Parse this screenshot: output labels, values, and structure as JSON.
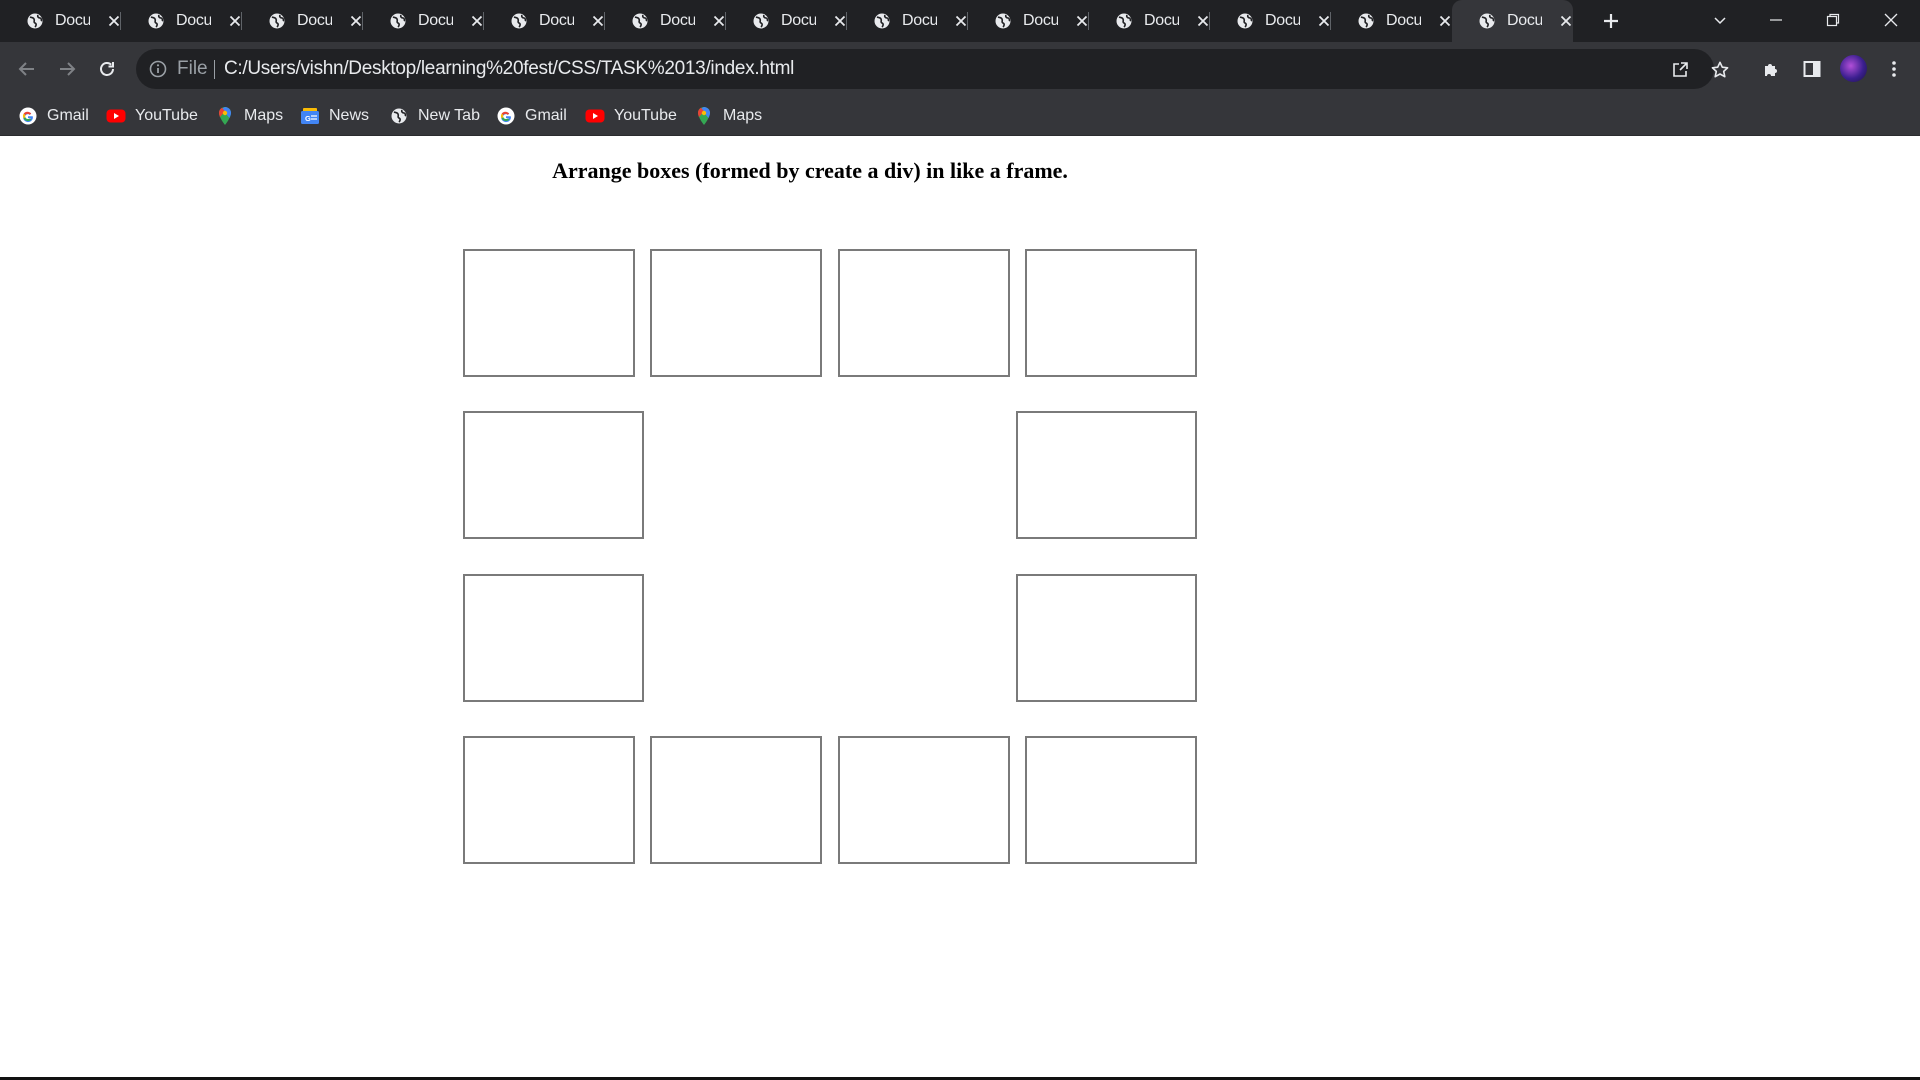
{
  "browser": {
    "tabs": [
      {
        "title": "Document",
        "active": false
      },
      {
        "title": "Document",
        "active": false
      },
      {
        "title": "Document",
        "active": false
      },
      {
        "title": "Document",
        "active": false
      },
      {
        "title": "Document",
        "active": false
      },
      {
        "title": "Document",
        "active": false
      },
      {
        "title": "Document",
        "active": false
      },
      {
        "title": "Document",
        "active": false
      },
      {
        "title": "Document",
        "active": false
      },
      {
        "title": "Document",
        "active": false
      },
      {
        "title": "Document",
        "active": false
      },
      {
        "title": "Document",
        "active": false
      },
      {
        "title": "Document",
        "active": true
      }
    ],
    "address": {
      "scheme_label": "File",
      "url": "C:/Users/vishn/Desktop/learning%20fest/CSS/TASK%2013/index.html"
    },
    "bookmarks": [
      {
        "label": "Gmail",
        "icon": "google-icon"
      },
      {
        "label": "YouTube",
        "icon": "youtube-icon"
      },
      {
        "label": "Maps",
        "icon": "maps-icon"
      },
      {
        "label": "News",
        "icon": "news-icon"
      },
      {
        "label": "New Tab",
        "icon": "globe-icon"
      },
      {
        "label": "Gmail",
        "icon": "google-icon"
      },
      {
        "label": "YouTube",
        "icon": "youtube-icon"
      },
      {
        "label": "Maps",
        "icon": "maps-icon"
      }
    ]
  },
  "page": {
    "heading": "Arrange boxes (formed by create a div) in like a frame.",
    "box_count": 12
  }
}
